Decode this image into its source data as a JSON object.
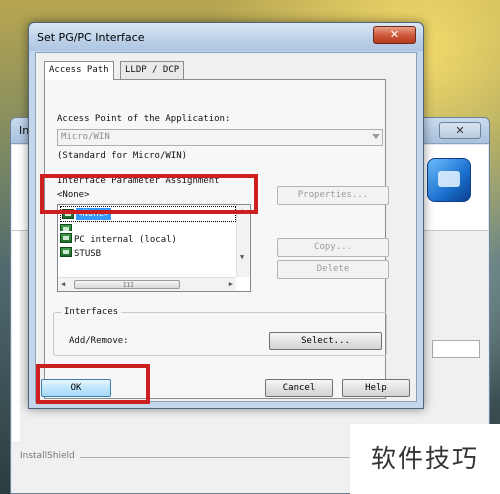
{
  "background_window": {
    "title_fragment": "In",
    "close_glyph": "✕",
    "footer_label": "InstallShield"
  },
  "dialog": {
    "title": "Set PG/PC Interface",
    "close_glyph": "✕",
    "tabs": [
      {
        "label": "Access Path",
        "active": true
      },
      {
        "label": "LLDP / DCP",
        "active": false
      }
    ],
    "access_point": {
      "label": "Access Point of the Application:",
      "value": "Micro/WIN",
      "hint": "(Standard for Micro/WIN)"
    },
    "interface_assignment": {
      "label": "Interface Parameter Assignment",
      "current_value": "<None>",
      "selected_item": "<None>",
      "items": [
        "",
        "PC internal (local)",
        "STUSB"
      ]
    },
    "side_buttons": {
      "properties": "Properties...",
      "copy": "Copy...",
      "delete": "Delete"
    },
    "interfaces": {
      "group_title": "Interfaces",
      "add_remove_label": "Add/Remove:",
      "select_button": "Select..."
    },
    "footer_buttons": {
      "ok": "OK",
      "cancel": "Cancel",
      "help": "Help"
    },
    "scrollbar_grip": "III",
    "highlight_color": "#cc1f1f"
  },
  "watermark": {
    "text": "软件技巧"
  }
}
